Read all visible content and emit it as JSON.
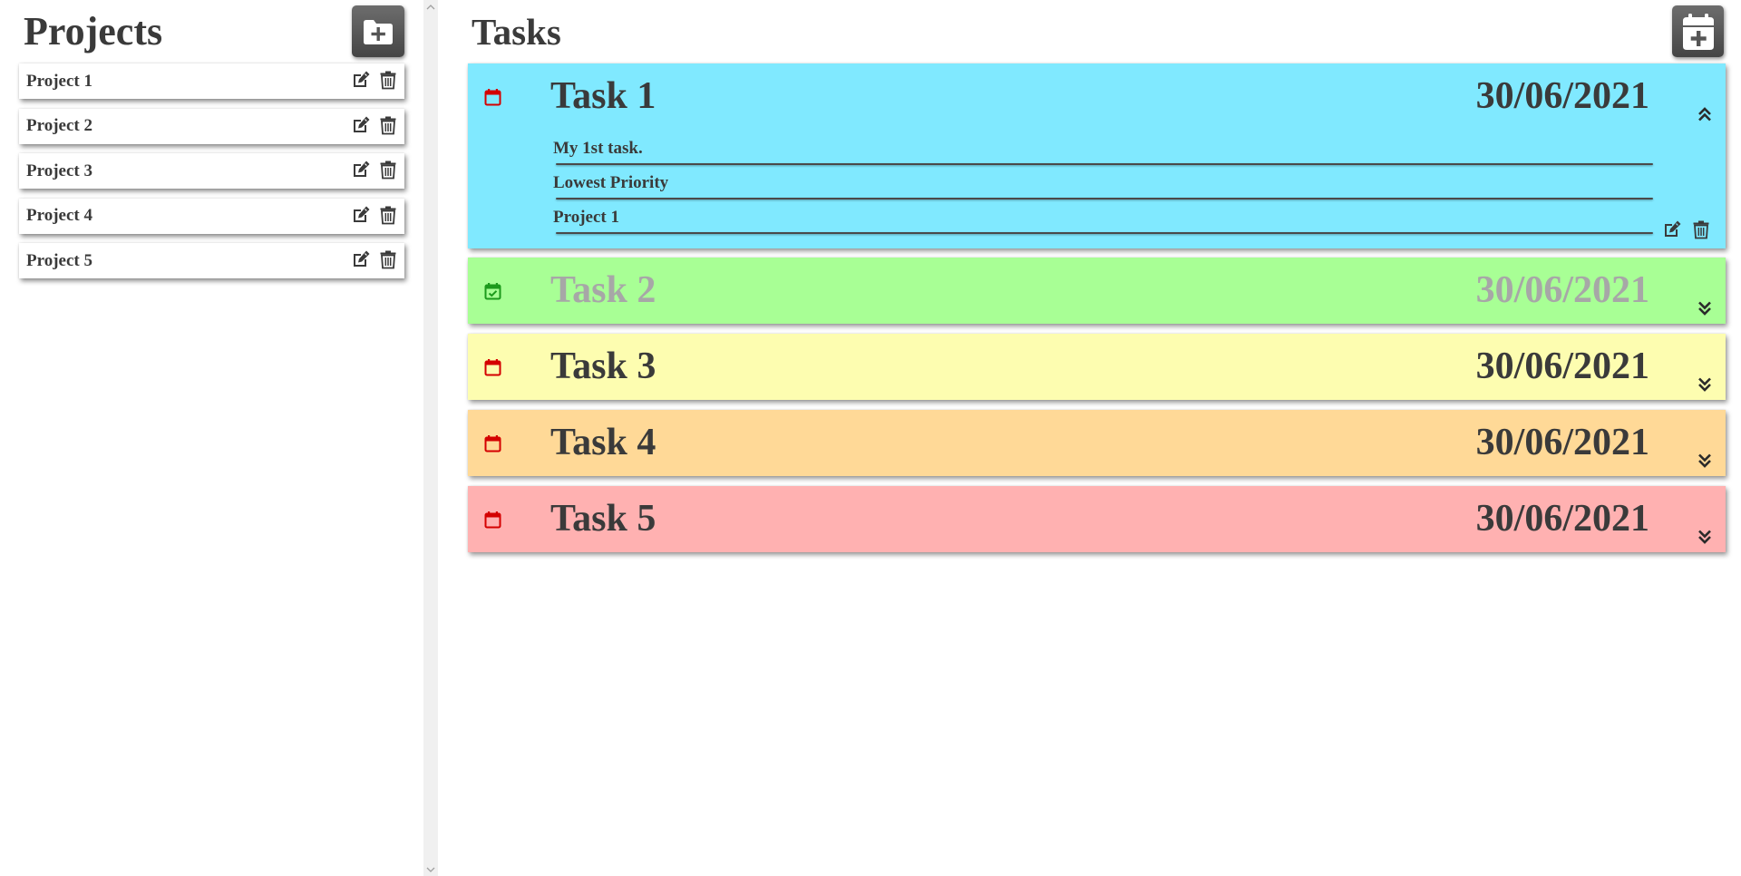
{
  "projects": {
    "title": "Projects",
    "items": [
      {
        "label": "Project 1"
      },
      {
        "label": "Project 2"
      },
      {
        "label": "Project 3"
      },
      {
        "label": "Project 4"
      },
      {
        "label": "Project 5"
      }
    ],
    "icons": {
      "add": "folder-plus-icon",
      "edit": "edit-icon",
      "delete": "trash-icon"
    }
  },
  "tasks": {
    "title": "Tasks",
    "items": [
      {
        "title": "Task 1",
        "date": "30/06/2021",
        "status": "pending",
        "color": "#80e9ff",
        "expanded": true,
        "description": "My 1st task.",
        "priority": "Lowest Priority",
        "project": "Project 1"
      },
      {
        "title": "Task 2",
        "date": "30/06/2021",
        "status": "done",
        "color": "#a8ff95",
        "expanded": false
      },
      {
        "title": "Task 3",
        "date": "30/06/2021",
        "status": "pending",
        "color": "#fdfdb0",
        "expanded": false
      },
      {
        "title": "Task 4",
        "date": "30/06/2021",
        "status": "pending",
        "color": "#ffd997",
        "expanded": false
      },
      {
        "title": "Task 5",
        "date": "30/06/2021",
        "status": "pending",
        "color": "#ffb1b1",
        "expanded": false
      }
    ],
    "icons": {
      "add": "calendar-plus-icon",
      "pending": "calendar-icon",
      "done": "calendar-check-icon",
      "collapse": "chevrons-up-icon",
      "expand": "chevrons-down-icon"
    }
  },
  "colors": {
    "pending_icon": "#d40000",
    "done_icon": "#1c9a1c",
    "text": "#3a3a3a",
    "done_text": "#a7a7a7"
  }
}
